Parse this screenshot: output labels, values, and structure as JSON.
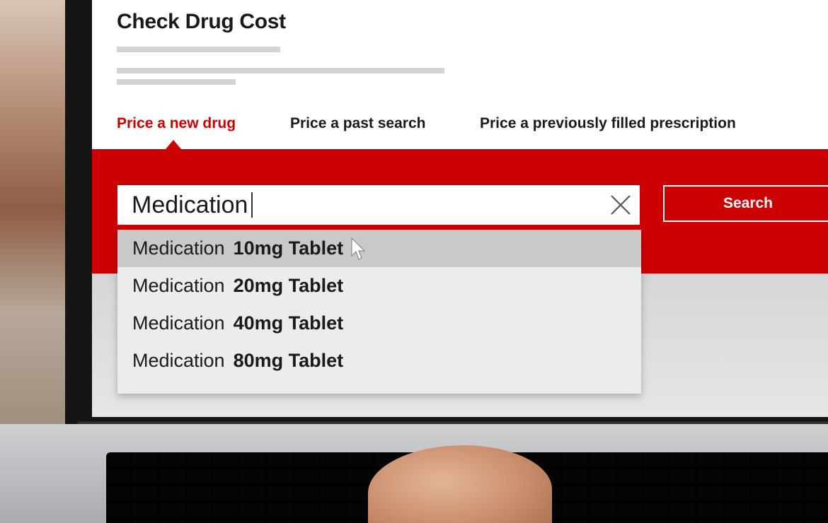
{
  "page": {
    "title": "Check Drug Cost"
  },
  "tabs": [
    {
      "label": "Price a new drug",
      "active": true
    },
    {
      "label": "Price a past search",
      "active": false
    },
    {
      "label": "Price a previously filled prescription",
      "active": false
    }
  ],
  "search": {
    "value": "Medication",
    "button_label": "Search",
    "clear_icon": "close-icon"
  },
  "suggestions": [
    {
      "name": "Medication",
      "dose": "10mg Tablet",
      "highlighted": true
    },
    {
      "name": "Medication",
      "dose": "20mg Tablet",
      "highlighted": false
    },
    {
      "name": "Medication",
      "dose": "40mg Tablet",
      "highlighted": false
    },
    {
      "name": "Medication",
      "dose": "80mg Tablet",
      "highlighted": false
    }
  ],
  "colors": {
    "brand_red": "#cc0000",
    "text": "#1a1a1a",
    "dropdown_bg": "#ececec",
    "dropdown_highlight": "#c9c9c9"
  },
  "icons": {
    "clear": "close-icon",
    "cursor": "mouse-pointer-icon",
    "tab_indicator": "caret-up-icon"
  }
}
